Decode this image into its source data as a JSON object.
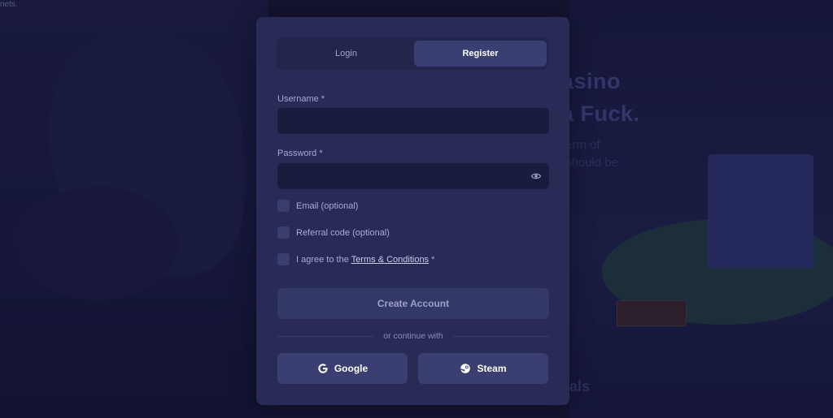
{
  "background": {
    "top_note": "nets.",
    "hero_line1": "asino",
    "hero_line2": "a Fuck.",
    "hero_sub1": "erm of",
    "hero_sub2": "should be",
    "bottom_text": "als"
  },
  "tabs": {
    "login": "Login",
    "register": "Register"
  },
  "form": {
    "username_label": "Username *",
    "username_value": "",
    "password_label": "Password *",
    "password_value": "",
    "email_option": "Email (optional)",
    "referral_option": "Referral code (optional)",
    "agree_prefix": "I agree to the ",
    "terms_link": "Terms & Conditions",
    "agree_suffix": " *",
    "create_button": "Create Account",
    "divider_text": "or continue with"
  },
  "social": {
    "google": "Google",
    "steam": "Steam"
  },
  "icons": {
    "password_toggle": "eye-icon",
    "google": "google-icon",
    "steam": "steam-icon"
  },
  "colors": {
    "card": "#272b55",
    "active_tab": "#3a3f72",
    "input": "#1a1c3d",
    "button": "#3a3e70"
  }
}
